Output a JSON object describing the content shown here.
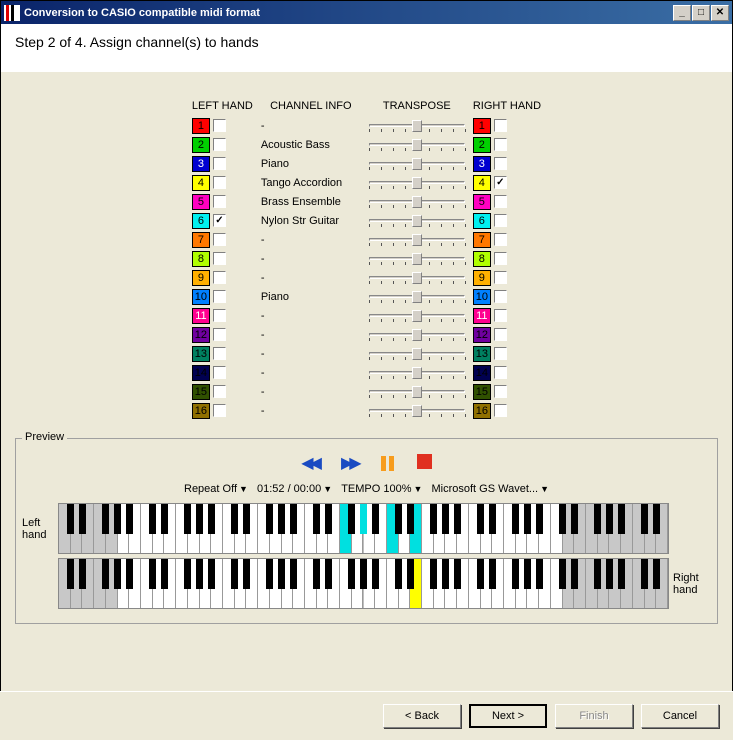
{
  "window": {
    "title": "Conversion to CASIO compatible midi format"
  },
  "step": {
    "title": "Step 2 of 4. Assign channel(s) to hands"
  },
  "headers": {
    "left": "LEFT HAND",
    "info": "CHANNEL INFO",
    "transpose": "TRANSPOSE",
    "right": "RIGHT HAND"
  },
  "channels": [
    {
      "n": "1",
      "color": "#ff0000",
      "fg": "#000",
      "leftChecked": false,
      "rightChecked": false,
      "info": "-"
    },
    {
      "n": "2",
      "color": "#00d000",
      "fg": "#000",
      "leftChecked": false,
      "rightChecked": false,
      "info": "Acoustic Bass"
    },
    {
      "n": "3",
      "color": "#0000d0",
      "fg": "#fff",
      "leftChecked": false,
      "rightChecked": false,
      "info": "Piano"
    },
    {
      "n": "4",
      "color": "#ffff00",
      "fg": "#000",
      "leftChecked": false,
      "rightChecked": true,
      "info": "Tango Accordion"
    },
    {
      "n": "5",
      "color": "#ff00c0",
      "fg": "#000",
      "leftChecked": false,
      "rightChecked": false,
      "info": "Brass Ensemble"
    },
    {
      "n": "6",
      "color": "#00f0f0",
      "fg": "#000",
      "leftChecked": true,
      "rightChecked": false,
      "info": "Nylon Str Guitar"
    },
    {
      "n": "7",
      "color": "#ff7800",
      "fg": "#000",
      "leftChecked": false,
      "rightChecked": false,
      "info": "-"
    },
    {
      "n": "8",
      "color": "#b0ff00",
      "fg": "#000",
      "leftChecked": false,
      "rightChecked": false,
      "info": "-"
    },
    {
      "n": "9",
      "color": "#ffb000",
      "fg": "#000",
      "leftChecked": false,
      "rightChecked": false,
      "info": "-"
    },
    {
      "n": "10",
      "color": "#0080ff",
      "fg": "#000",
      "leftChecked": false,
      "rightChecked": false,
      "info": "Piano"
    },
    {
      "n": "11",
      "color": "#ff0090",
      "fg": "#fff",
      "leftChecked": false,
      "rightChecked": false,
      "info": "-"
    },
    {
      "n": "12",
      "color": "#7000a0",
      "fg": "#000",
      "leftChecked": false,
      "rightChecked": false,
      "info": "-"
    },
    {
      "n": "13",
      "color": "#008060",
      "fg": "#000",
      "leftChecked": false,
      "rightChecked": false,
      "info": "-"
    },
    {
      "n": "14",
      "color": "#000050",
      "fg": "#000",
      "leftChecked": false,
      "rightChecked": false,
      "info": "-"
    },
    {
      "n": "15",
      "color": "#305000",
      "fg": "#000",
      "leftChecked": false,
      "rightChecked": false,
      "info": "-"
    },
    {
      "n": "16",
      "color": "#907000",
      "fg": "#000",
      "leftChecked": false,
      "rightChecked": false,
      "info": "-"
    }
  ],
  "preview": {
    "legend": "Preview",
    "repeat": "Repeat Off",
    "time": "01:52 / 00:00",
    "tempo": "TEMPO 100%",
    "device": "Microsoft GS Wavet...",
    "leftLabel": "Left hand",
    "rightLabel": "Right hand",
    "leftHighlights": {
      "cyan_white": [
        24,
        28,
        30
      ],
      "cyan_black": [
        25
      ]
    },
    "rightHighlights": {
      "yellow_white": [
        30
      ]
    }
  },
  "buttons": {
    "back": "< Back",
    "next": "Next >",
    "finish": "Finish",
    "cancel": "Cancel"
  }
}
